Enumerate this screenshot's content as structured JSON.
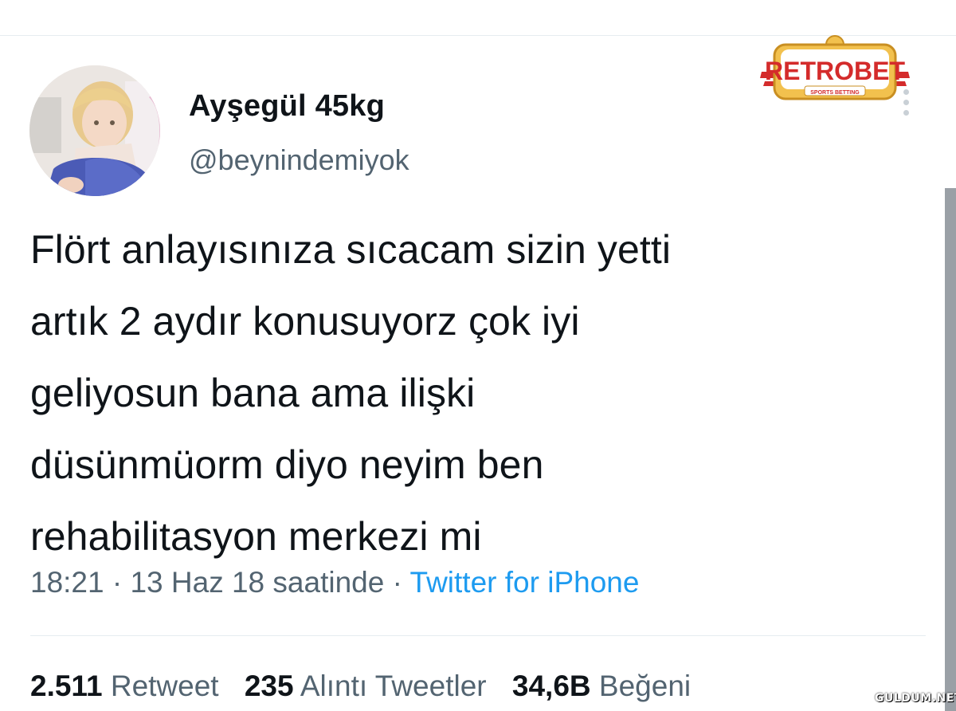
{
  "tweet": {
    "author": {
      "display_name": "Ayşegül 45kg",
      "handle": "@beynindemiyok"
    },
    "text_lines": [
      "Flört anlayısınıza sıcacam sizin yetti",
      "artık 2 aydır konusuyorz çok iyi",
      "geliyosun bana ama ilişki",
      "düsünmüorm diyo neyim ben",
      "rehabilitasyon merkezi mi"
    ],
    "timestamp": "18:21 · 13 Haz 18 saatinde · ",
    "source": "Twitter for iPhone",
    "stats": {
      "retweets_count": "2.511",
      "retweets_label": "Retweet",
      "quotes_count": "235",
      "quotes_label": "Alıntı Tweetler",
      "likes_count": "34,6B",
      "likes_label": "Beğeni"
    }
  },
  "overlay": {
    "logo_text": "RETROBET",
    "logo_subtext": "SPORTS BETTING",
    "watermark": "GULDUM.NET"
  },
  "colors": {
    "text": "#0f1419",
    "muted": "#536471",
    "link": "#1d9bf0",
    "logo_red": "#d42b2b",
    "logo_gold": "#f2c14e"
  },
  "icons": {
    "more": "more-vertical-icon",
    "avatar": "avatar-photo"
  }
}
